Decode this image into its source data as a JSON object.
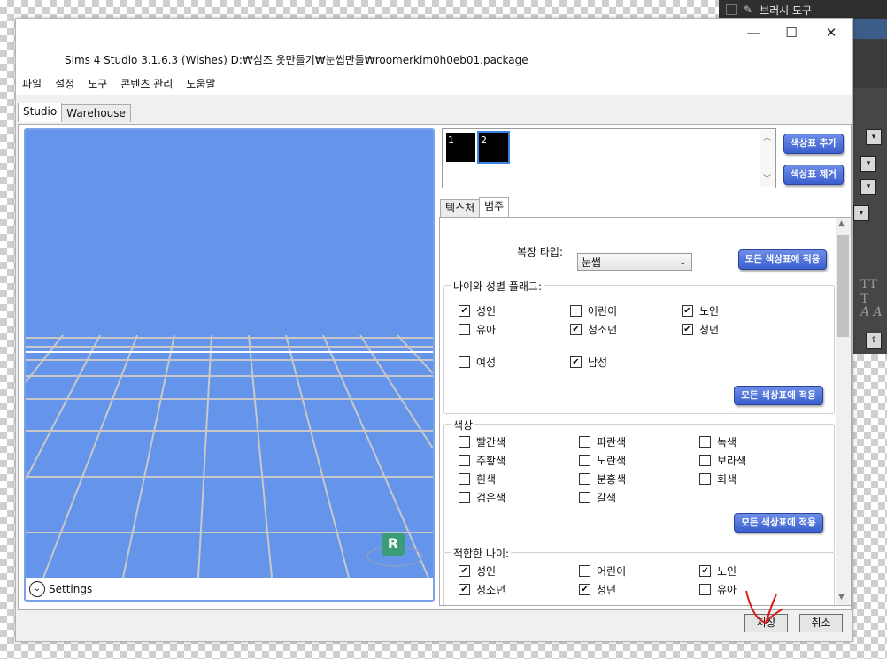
{
  "background_app": {
    "brush_tool_label": "브러시 도구",
    "font_glyph_tt": "TT T",
    "font_glyph_a": "A A"
  },
  "window": {
    "title": "Sims 4 Studio 3.1.6.3 (Wishes)  D:₩심즈 옷만들기₩눈썹만들₩roomerkim0h0eb01.package",
    "minimize": "—",
    "maximize": "☐",
    "close": "✕"
  },
  "menu": [
    "파일",
    "설정",
    "도구",
    "콘텐츠 관리",
    "도움말"
  ],
  "main_tabs": [
    "Studio",
    "Warehouse"
  ],
  "viewport": {
    "settings_label": "Settings",
    "badge_letter": "R",
    "background_color": "#6495ea"
  },
  "swatches": {
    "items": [
      "1",
      "2"
    ],
    "add_button": "색상표 추가",
    "remove_button": "색상표 제거"
  },
  "sub_tabs": [
    "텍스처",
    "범주"
  ],
  "category": {
    "clothing_type_label": "복장 타입:",
    "clothing_type_value": "눈썹",
    "apply_all": "모든 색상표에 적용",
    "age_gender": {
      "label": "나이와 성별 플래그:",
      "items": [
        {
          "label": "성인",
          "checked": true
        },
        {
          "label": "어린이",
          "checked": false
        },
        {
          "label": "노인",
          "checked": true
        },
        {
          "label": "유아",
          "checked": false
        },
        {
          "label": "청소년",
          "checked": true
        },
        {
          "label": "청년",
          "checked": true
        },
        {
          "label": "여성",
          "checked": false
        },
        {
          "label": "남성",
          "checked": true
        }
      ]
    },
    "color": {
      "label": "색상",
      "items": [
        {
          "label": "빨간색",
          "checked": false
        },
        {
          "label": "파란색",
          "checked": false
        },
        {
          "label": "녹색",
          "checked": false
        },
        {
          "label": "주황색",
          "checked": false
        },
        {
          "label": "노란색",
          "checked": false
        },
        {
          "label": "보라색",
          "checked": false
        },
        {
          "label": "흰색",
          "checked": false
        },
        {
          "label": "분홍색",
          "checked": false
        },
        {
          "label": "회색",
          "checked": false
        },
        {
          "label": "검은색",
          "checked": false
        },
        {
          "label": "갈색",
          "checked": false
        }
      ]
    },
    "suitable_age": {
      "label": "적합한 나이:",
      "items": [
        {
          "label": "성인",
          "checked": true
        },
        {
          "label": "어린이",
          "checked": false
        },
        {
          "label": "노인",
          "checked": true
        },
        {
          "label": "청소년",
          "checked": true
        },
        {
          "label": "청년",
          "checked": true
        },
        {
          "label": "유아",
          "checked": false
        }
      ]
    }
  },
  "footer": {
    "save": "저장",
    "cancel": "취소"
  }
}
